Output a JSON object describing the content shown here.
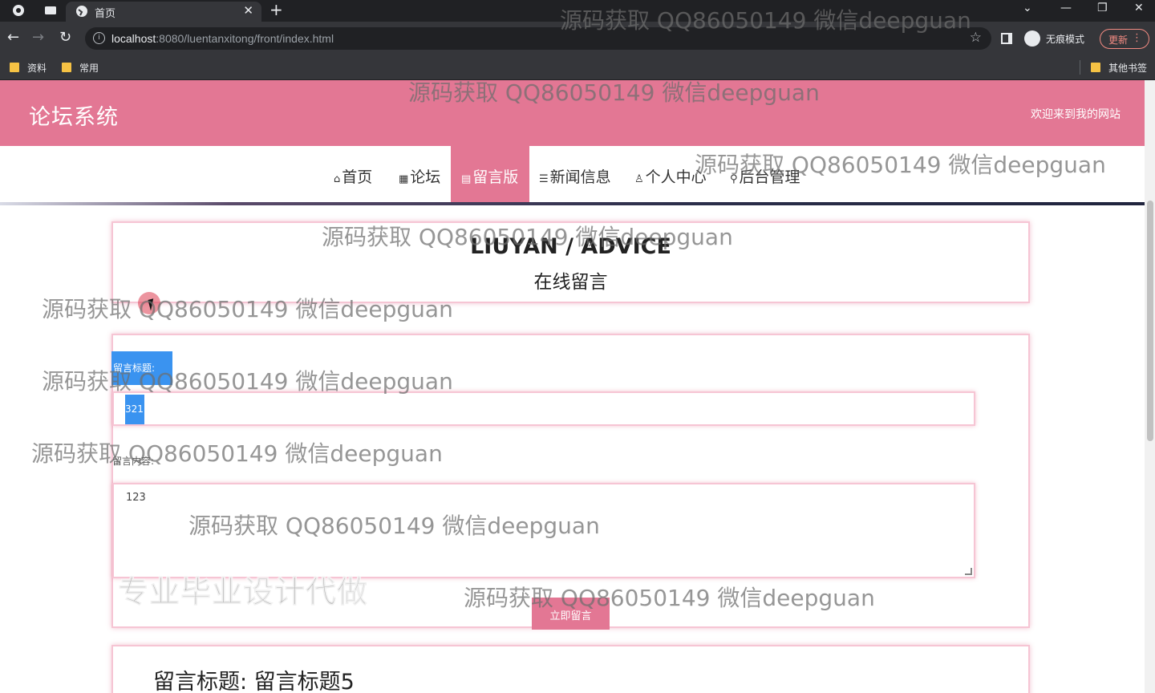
{
  "browser": {
    "tab_title": "首页",
    "url_host": "localhost",
    "url_rest": ":8080/luentanxitong/front/index.html",
    "incognito_label": "无痕模式",
    "update_label": "更新",
    "bookmarks": [
      "资料",
      "常用"
    ],
    "other_bookmarks": "其他书签"
  },
  "site": {
    "title": "论坛系统",
    "welcome": "欢迎来到我的网站"
  },
  "nav": {
    "items": [
      {
        "icon": "⌂",
        "label": "首页"
      },
      {
        "icon": "▦",
        "label": "论坛"
      },
      {
        "icon": "▤",
        "label": "留言版"
      },
      {
        "icon": "☰",
        "label": "新闻信息"
      },
      {
        "icon": "♙",
        "label": "个人中心"
      },
      {
        "icon": "⚲",
        "label": "后台管理"
      }
    ],
    "active_index": 2
  },
  "heading": {
    "en": "LIUYAN / ADVICE",
    "cn": "在线留言"
  },
  "form": {
    "title_label": "留言标题:",
    "title_value": "321",
    "content_label": "留言内容:",
    "content_value": "123",
    "submit_label": "立即留言"
  },
  "messages": [
    {
      "title": "留言标题:  留言标题5"
    }
  ],
  "overlay": {
    "watermark_text": "源码获取 QQ86050149 微信deepguan",
    "promo_text": "专业毕业设计代做"
  },
  "colors": {
    "brand_pink": "#e37794",
    "selection_blue": "#3a93f0"
  }
}
